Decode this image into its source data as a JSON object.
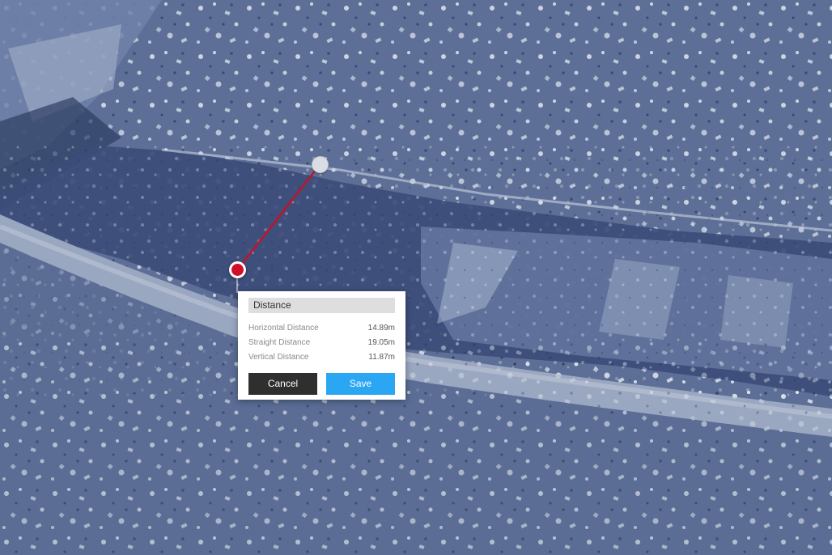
{
  "colors": {
    "marker_start": "#d0102a",
    "marker_end": "#d9dde4",
    "measure_line": "#c0142a",
    "save_button": "#2aa6f3",
    "cancel_button": "#2f2f2f"
  },
  "measurement_panel": {
    "title": "Distance",
    "rows": [
      {
        "label": "Horizontal Distance",
        "value": "14.89m"
      },
      {
        "label": "Straight Distance",
        "value": "19.05m"
      },
      {
        "label": "Vertical Distance",
        "value": "11.87m"
      }
    ],
    "cancel_label": "Cancel",
    "save_label": "Save"
  }
}
